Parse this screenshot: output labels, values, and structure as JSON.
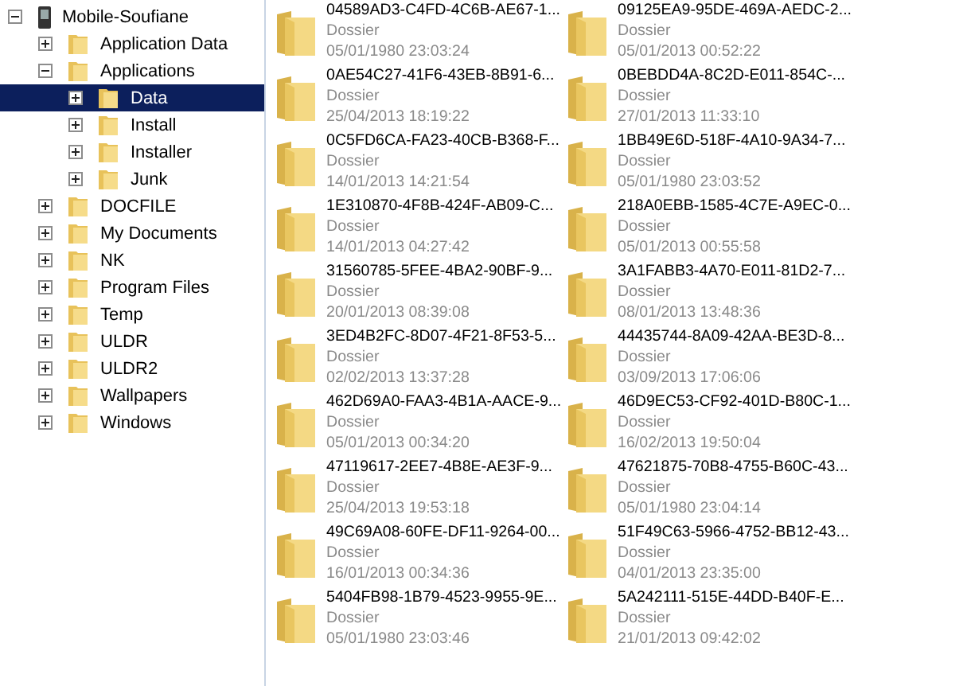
{
  "tree": {
    "label": "Mobile-Soufiane",
    "expanded": true,
    "selected": false,
    "children": [
      {
        "label": "Application Data",
        "expanded": false,
        "selected": false
      },
      {
        "label": "Applications",
        "expanded": true,
        "selected": false,
        "children": [
          {
            "label": "Data",
            "expanded": false,
            "selected": true
          },
          {
            "label": "Install",
            "expanded": false,
            "selected": false
          },
          {
            "label": "Installer",
            "expanded": false,
            "selected": false
          },
          {
            "label": "Junk",
            "expanded": false,
            "selected": false
          }
        ]
      },
      {
        "label": "DOCFILE",
        "expanded": false,
        "selected": false
      },
      {
        "label": "My Documents",
        "expanded": false,
        "selected": false
      },
      {
        "label": "NK",
        "expanded": false,
        "selected": false
      },
      {
        "label": "Program Files",
        "expanded": false,
        "selected": false
      },
      {
        "label": "Temp",
        "expanded": false,
        "selected": false
      },
      {
        "label": "ULDR",
        "expanded": false,
        "selected": false
      },
      {
        "label": "ULDR2",
        "expanded": false,
        "selected": false
      },
      {
        "label": "Wallpapers",
        "expanded": false,
        "selected": false
      },
      {
        "label": "Windows",
        "expanded": false,
        "selected": false
      }
    ]
  },
  "files": [
    {
      "name": "04589AD3-C4FD-4C6B-AE67-1...",
      "type": "Dossier",
      "date": "05/01/1980 23:03:24"
    },
    {
      "name": "09125EA9-95DE-469A-AEDC-2...",
      "type": "Dossier",
      "date": "05/01/2013 00:52:22"
    },
    {
      "name": "0AE54C27-41F6-43EB-8B91-6...",
      "type": "Dossier",
      "date": "25/04/2013 18:19:22"
    },
    {
      "name": "0BEBDD4A-8C2D-E011-854C-...",
      "type": "Dossier",
      "date": "27/01/2013 11:33:10"
    },
    {
      "name": "0C5FD6CA-FA23-40CB-B368-F...",
      "type": "Dossier",
      "date": "14/01/2013 14:21:54"
    },
    {
      "name": "1BB49E6D-518F-4A10-9A34-7...",
      "type": "Dossier",
      "date": "05/01/1980 23:03:52"
    },
    {
      "name": "1E310870-4F8B-424F-AB09-C...",
      "type": "Dossier",
      "date": "14/01/2013 04:27:42"
    },
    {
      "name": "218A0EBB-1585-4C7E-A9EC-0...",
      "type": "Dossier",
      "date": "05/01/2013 00:55:58"
    },
    {
      "name": "31560785-5FEE-4BA2-90BF-9...",
      "type": "Dossier",
      "date": "20/01/2013 08:39:08"
    },
    {
      "name": "3A1FABB3-4A70-E011-81D2-7...",
      "type": "Dossier",
      "date": "08/01/2013 13:48:36"
    },
    {
      "name": "3ED4B2FC-8D07-4F21-8F53-5...",
      "type": "Dossier",
      "date": "02/02/2013 13:37:28"
    },
    {
      "name": "44435744-8A09-42AA-BE3D-8...",
      "type": "Dossier",
      "date": "03/09/2013 17:06:06"
    },
    {
      "name": "462D69A0-FAA3-4B1A-AACE-9...",
      "type": "Dossier",
      "date": "05/01/2013 00:34:20"
    },
    {
      "name": "46D9EC53-CF92-401D-B80C-1...",
      "type": "Dossier",
      "date": "16/02/2013 19:50:04"
    },
    {
      "name": "47119617-2EE7-4B8E-AE3F-9...",
      "type": "Dossier",
      "date": "25/04/2013 19:53:18"
    },
    {
      "name": "47621875-70B8-4755-B60C-43...",
      "type": "Dossier",
      "date": "05/01/1980 23:04:14"
    },
    {
      "name": "49C69A08-60FE-DF11-9264-00...",
      "type": "Dossier",
      "date": "16/01/2013 00:34:36"
    },
    {
      "name": "51F49C63-5966-4752-BB12-43...",
      "type": "Dossier",
      "date": "04/01/2013 23:35:00"
    },
    {
      "name": "5404FB98-1B79-4523-9955-9E...",
      "type": "Dossier",
      "date": "05/01/1980 23:03:46"
    },
    {
      "name": "5A242111-515E-44DD-B40F-E...",
      "type": "Dossier",
      "date": "21/01/2013 09:42:02"
    }
  ]
}
